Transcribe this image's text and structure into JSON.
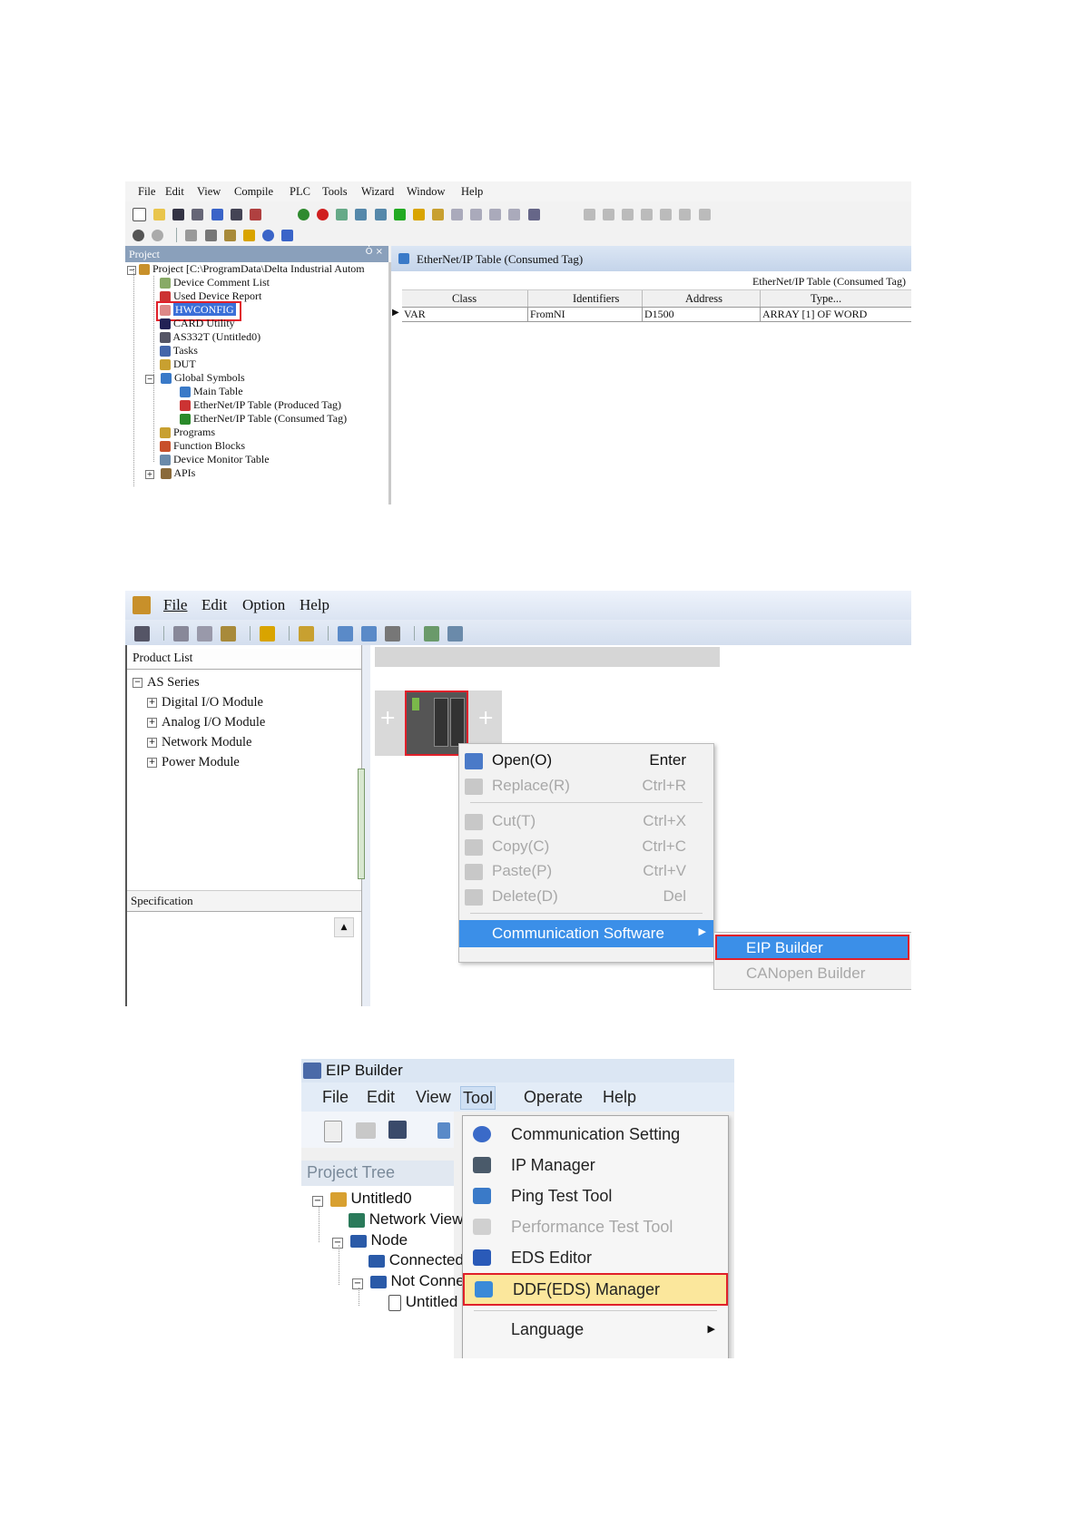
{
  "shot1": {
    "menu": [
      "File",
      "Edit",
      "View",
      "Compile",
      "PLC",
      "Tools",
      "Wizard",
      "Window",
      "Help"
    ],
    "project_header": "Project",
    "pin_glyph": "Ȱ ×",
    "tree": [
      "Project [C:\\ProgramData\\Delta Industrial Autom",
      "Device Comment List",
      "Used Device Report",
      "HWCONFIG",
      "CARD Utility",
      "AS332T  (Untitled0)",
      "Tasks",
      "DUT",
      "Global Symbols",
      "Main Table",
      "EtherNet/IP Table (Produced Tag)",
      "EtherNet/IP Table (Consumed Tag)",
      "Programs",
      "Function Blocks",
      "Device Monitor Table",
      "APIs"
    ],
    "tab_title": "EtherNet/IP Table (Consumed Tag)",
    "grid_title": "EtherNet/IP Table (Consumed Tag)",
    "columns": [
      "Class",
      "Identifiers",
      "Address",
      "Type..."
    ],
    "row": [
      "VAR",
      "FromNI",
      "D1500",
      "ARRAY [1] OF WORD"
    ],
    "highlight_color": "#e0202a"
  },
  "shot2": {
    "menu": [
      "File",
      "Edit",
      "Option",
      "Help"
    ],
    "product_list_header": "Product List",
    "product_tree": [
      "AS Series",
      "Digital I/O Module",
      "Analog I/O Module",
      "Network Module",
      "Power Module"
    ],
    "specification_header": "Specification",
    "context_menu": [
      {
        "label": "Open(O)",
        "key": "Enter",
        "disabled": false
      },
      {
        "label": "Replace(R)",
        "key": "Ctrl+R",
        "disabled": true
      },
      {
        "label": "Cut(T)",
        "key": "Ctrl+X",
        "disabled": true
      },
      {
        "label": "Copy(C)",
        "key": "Ctrl+C",
        "disabled": true
      },
      {
        "label": "Paste(P)",
        "key": "Ctrl+V",
        "disabled": true
      },
      {
        "label": "Delete(D)",
        "key": "Del",
        "disabled": true
      }
    ],
    "comm_software": "Communication Software",
    "submenu": [
      "EIP Builder",
      "CANopen Builder"
    ],
    "plus": "+",
    "selection_color": "#3b8fe8"
  },
  "shot3": {
    "title": "EIP Builder",
    "menu": [
      "File",
      "Edit",
      "View",
      "Tool",
      "Operate",
      "Help"
    ],
    "project_tree_header": "Project Tree",
    "tree": [
      "Untitled0",
      "Network View",
      "Node",
      "Connected",
      "Not Connected",
      "Untitled"
    ],
    "tool_menu": [
      {
        "label": "Communication Setting",
        "disabled": false
      },
      {
        "label": "IP Manager",
        "disabled": false
      },
      {
        "label": "Ping Test Tool",
        "disabled": false
      },
      {
        "label": "Performance Test Tool",
        "disabled": true
      },
      {
        "label": "EDS Editor",
        "disabled": false
      },
      {
        "label": "DDF(EDS) Manager",
        "disabled": false
      },
      {
        "label": "Language",
        "disabled": false
      }
    ],
    "hover_color": "#fbe79c"
  }
}
